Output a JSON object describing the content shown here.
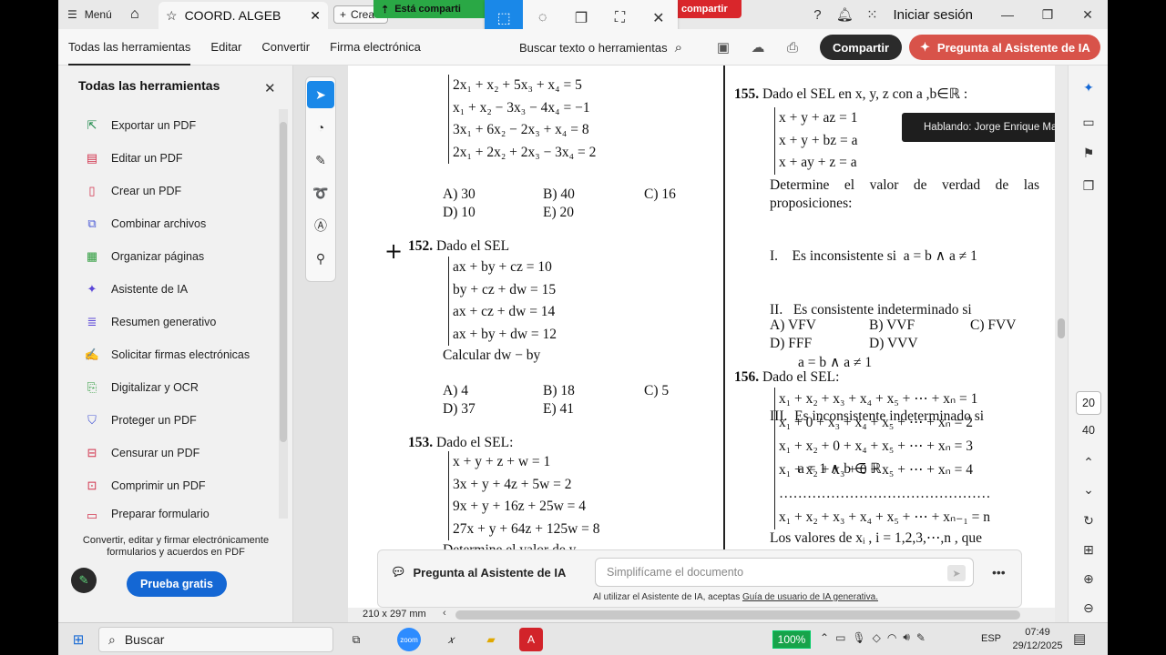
{
  "titlebar": {
    "menu_label": "Menú",
    "tab_title": "COORD. ALGEB",
    "new_tab_label": "Crea",
    "share_green_text": "Está comparti",
    "share_red_text": "compartir",
    "signin_label": "Iniciar sesión"
  },
  "menubar": {
    "items": [
      "Todas las herramientas",
      "Editar",
      "Convertir",
      "Firma electrónica"
    ],
    "search_label": "Buscar texto o herramientas",
    "share_button": "Compartir",
    "ai_button": "Pregunta al Asistente de IA"
  },
  "left_panel": {
    "title": "Todas las herramientas",
    "tools": [
      {
        "label": "Exportar un PDF",
        "icon": "export-pdf-icon",
        "color": "#1f8a4c"
      },
      {
        "label": "Editar un PDF",
        "icon": "edit-pdf-icon",
        "color": "#d2334d"
      },
      {
        "label": "Crear un PDF",
        "icon": "create-pdf-icon",
        "color": "#d2334d"
      },
      {
        "label": "Combinar archivos",
        "icon": "combine-files-icon",
        "color": "#4b5bd6"
      },
      {
        "label": "Organizar páginas",
        "icon": "organize-pages-icon",
        "color": "#2e9c3d"
      },
      {
        "label": "Asistente de IA",
        "icon": "ai-assistant-icon",
        "color": "#5b46d8"
      },
      {
        "label": "Resumen generativo",
        "icon": "generative-summary-icon",
        "color": "#5b46d8"
      },
      {
        "label": "Solicitar firmas electrónicas",
        "icon": "request-signatures-icon",
        "color": "#8a3fc4"
      },
      {
        "label": "Digitalizar y OCR",
        "icon": "scan-ocr-icon",
        "color": "#2e9c3d"
      },
      {
        "label": "Proteger un PDF",
        "icon": "protect-pdf-icon",
        "color": "#4b5bd6"
      },
      {
        "label": "Censurar un PDF",
        "icon": "redact-pdf-icon",
        "color": "#d2334d"
      },
      {
        "label": "Comprimir un PDF",
        "icon": "compress-pdf-icon",
        "color": "#d2334d"
      },
      {
        "label": "Preparar formulario",
        "icon": "prepare-form-icon",
        "color": "#d2334d"
      }
    ],
    "promo_text": "Convertir, editar y firmar electrónicamente formularios y acuerdos en PDF",
    "trial_button": "Prueba gratis"
  },
  "document": {
    "q151": {
      "system": [
        "2x₁ + x₂ + 5x₃ + x₄ = 5",
        "x₁ + x₂ − 3x₃ − 4x₄ = −1",
        "3x₁ + 6x₂ − 2x₃ + x₄ = 8",
        "2x₁ + 2x₂ + 2x₃ − 3x₄ = 2"
      ],
      "options": [
        "A)  30",
        "B)  40",
        "C)  16",
        "D)  10",
        "E)  20"
      ]
    },
    "q152": {
      "number": "152.",
      "title": "Dado el SEL",
      "system": [
        "ax + by + cz = 10",
        "by + cz + dw = 15",
        "ax + cz + dw = 14",
        "ax + by + dw = 12"
      ],
      "question": "Calcular dw − by",
      "options": [
        "A)  4",
        "B)  18",
        "C)  5",
        "D)  37",
        "E)  41"
      ]
    },
    "q153": {
      "number": "153.",
      "title": "Dado el SEL:",
      "system": [
        "x + y + z + w = 1",
        "3x + y + 4z + 5w = 2",
        "9x + y + 16z + 25w = 4",
        "27x + y + 64z + 125w = 8"
      ],
      "tail": "Determine el valor de y"
    },
    "q155": {
      "number": "155.",
      "title": "Dado el SEL en x, y, z con  a ,b∈ℝ :",
      "system": [
        "x + y + az = 1",
        "x + y + bz = a",
        "x + ay + z = a"
      ],
      "prompt": "Determine el valor de verdad de las proposiciones:",
      "props": [
        "I.    Es inconsistente si  a = b ∧ a ≠ 1",
        "II.   Es consistente indeterminado si",
        "        a = b ∧ a ≠ 1",
        "III.  Es inconsistente indeterminado si",
        "        a = 1 ∧ b ∈ ℝ"
      ],
      "options": [
        "A)  VFV",
        "B)  VVF",
        "C)  FVV",
        "D)  FFF",
        "D)  VVV"
      ]
    },
    "q156": {
      "number": "156.",
      "title": "Dado el SEL:",
      "system": [
        "x₁ + x₂ + x₃ + x₄ + x₅ + ⋯ + xₙ = 1",
        "x₁ + 0 + x₃ + x₄ + x₅ + ⋯ + xₙ = 2",
        "x₁ + x₂ + 0 + x₄ + x₅ + ⋯ + xₙ = 3",
        "x₁ + x₂ + x₃ + 0 + x₅ + ⋯ + xₙ = 4",
        "………………………………………",
        "x₁ + x₂ + x₃ + x₄ + x₅ + ⋯ + xₙ₋₁ = n"
      ],
      "tail": "Los valores de  xᵢ ,  i = 1,2,3,⋯,n ,  que"
    },
    "tooltip": "Hablando: Jorge Enrique Mayt...",
    "page_size": "210 x 297 mm"
  },
  "ai_bar": {
    "label": "Pregunta al Asistente de IA",
    "placeholder": "Simplifícame el documento",
    "disclaimer_prefix": "Al utilizar el Asistente de IA, aceptas",
    "disclaimer_link": "Guía de usuario de IA generativa."
  },
  "right_rail": {
    "page_current": "20",
    "page_total": "40"
  },
  "taskbar": {
    "search_label": "Buscar",
    "battery": "100%",
    "language": "ESP",
    "time": "07:49",
    "date": "29/12/2025"
  },
  "colors": {
    "accent_blue": "#1a88e8",
    "share_dark": "#2b2b2b",
    "ai_red": "#d8534a",
    "trial_blue": "#1467d4"
  }
}
